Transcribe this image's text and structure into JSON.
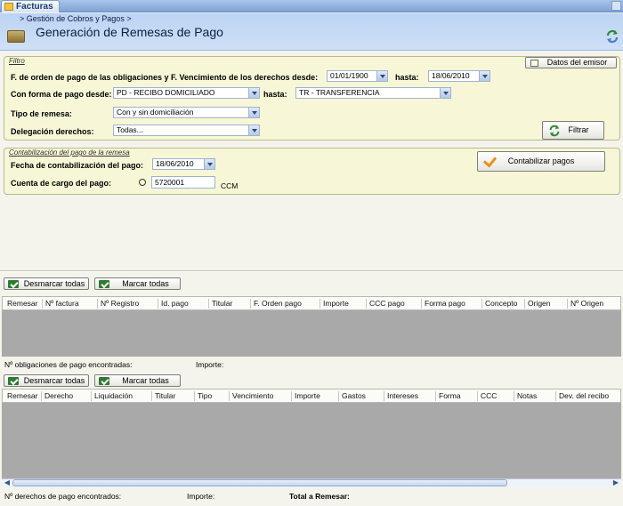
{
  "window": {
    "tab_title": "Facturas"
  },
  "header": {
    "breadcrumb": "> Gestión de Cobros y Pagos   >",
    "title": "Generación de Remesas de Pago"
  },
  "filtro": {
    "legend": "Filtro",
    "fechas_label": "F. de orden de pago de las obligaciones y F. Vencimiento de los derechos desde:",
    "fecha_desde": "01/01/1900",
    "hasta_label": "hasta:",
    "fecha_hasta": "18/06/2010",
    "forma_label": "Con forma de pago desde:",
    "forma_desde": "PD - RECIBO DOMICILIADO",
    "forma_hasta_label": "hasta:",
    "forma_hasta": "TR - TRANSFERENCIA",
    "tipo_label": "Tipo de remesa:",
    "tipo_value": "Con y sin domiciliación",
    "delegacion_label": "Delegación derechos:",
    "delegacion_value": "Todas...",
    "datos_emisor_label": "Datos del emisor",
    "filtrar_label": "Filtrar"
  },
  "contabilizacion": {
    "legend": "Contabilización del pago de la remesa",
    "fecha_label": "Fecha de contabilización del pago:",
    "fecha_value": "18/06/2010",
    "cuenta_label": "Cuenta de cargo del pago:",
    "cuenta_value": "5720001",
    "cuenta_suffix": "CCM",
    "contabilizar_label": "Contabilizar pagos"
  },
  "obligaciones": {
    "desmarcar_label": "Desmarcar todas",
    "marcar_label": "Marcar todas",
    "columns": [
      "Remesar",
      "Nº factura",
      "Nº Registro",
      "Id. pago",
      "Titular",
      "F. Orden pago",
      "Importe",
      "CCC pago",
      "Forma pago",
      "Concepto",
      "Origen",
      "Nº Origen"
    ],
    "found_label": "Nº obligaciones de pago encontradas:",
    "importe_label": "Importe:"
  },
  "derechos": {
    "desmarcar_label": "Desmarcar todas",
    "marcar_label": "Marcar todas",
    "columns": [
      "Remesar",
      "Derecho",
      "Liquidación",
      "Titular",
      "Tipo",
      "Vencimiento",
      "Importe",
      "Gastos",
      "Intereses",
      "Forma",
      "CCC",
      "Notas",
      "Dev. del recibo"
    ],
    "found_label": "Nº derechos de pago encontrados:",
    "importe_label": "Importe:",
    "total_label": "Total a Remesar:"
  },
  "colors": {
    "header_bg": "#c4d8f4",
    "panel_bg": "#f7f7d8",
    "grid_empty": "#a9a9a9",
    "accent_green": "#2f7a30",
    "check_orange": "#e8901a"
  }
}
